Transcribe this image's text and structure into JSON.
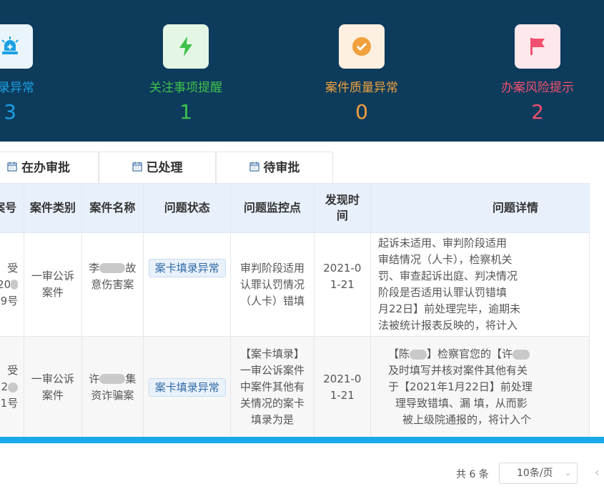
{
  "stats": [
    {
      "label": "填录异常",
      "value": "3",
      "color": "#1ba1e2",
      "icon": "alarm-light-icon",
      "icon_bg": "#e9f5fb"
    },
    {
      "label": "关注事项提醒",
      "value": "1",
      "color": "#3ec24a",
      "icon": "lightning-icon",
      "icon_bg": "#e3f7e4"
    },
    {
      "label": "案件质量异常",
      "value": "0",
      "color": "#f0a03c",
      "icon": "check-circle-icon",
      "icon_bg": "#fdf0e0"
    },
    {
      "label": "办案风险提示",
      "value": "2",
      "color": "#f0506e",
      "icon": "flag-icon",
      "icon_bg": "#fde8ec"
    }
  ],
  "tabs": [
    "在办审批",
    "已处理",
    "待审批"
  ],
  "table": {
    "headers": [
      "案号",
      "案件类别",
      "案件名称",
      "问题状态",
      "问题监控点",
      "发现时间",
      "问题详情"
    ],
    "rows": [
      {
        "case_no": [
          "受",
          "20",
          "9号"
        ],
        "category": [
          "一审公诉",
          "案件"
        ],
        "name": [
          "李",
          "故",
          "意伤害案"
        ],
        "status": "案卡填录异常",
        "monitor": [
          "审判阶段适用",
          "认罪认罚情况",
          "（人卡）错填"
        ],
        "time": [
          "2021-0",
          "1-21"
        ],
        "detail": [
          "起诉未适用、审判阶段适用",
          "审结情况（人卡），检察机关",
          "罚、审查起诉出庭、判决情况",
          "阶段是否适用认罪认罚错填",
          "月22日】前处理完毕，逾期未",
          "法被统计报表反映的，将计入"
        ]
      },
      {
        "case_no": [
          "受",
          "2",
          "1号"
        ],
        "category": [
          "一审公诉",
          "案件"
        ],
        "name": [
          "许",
          "集",
          "资诈骗案"
        ],
        "status": "案卡填录异常",
        "monitor": [
          "【案卡填录】",
          "一审公诉案件",
          "中案件其他有",
          "关情况的案卡",
          "填录为是"
        ],
        "time": [
          "2021-0",
          "1-21"
        ],
        "detail": [
          "【陈",
          "】检察官您的【许",
          "及时填写并核对案件其他有关",
          "于【2021年1月22日】前处理",
          "理导致错填、漏 填，从而影",
          "被上级院通报的，将计入个"
        ]
      }
    ]
  },
  "pagination": {
    "total": "共 6 条",
    "page_size": "10条/页"
  }
}
